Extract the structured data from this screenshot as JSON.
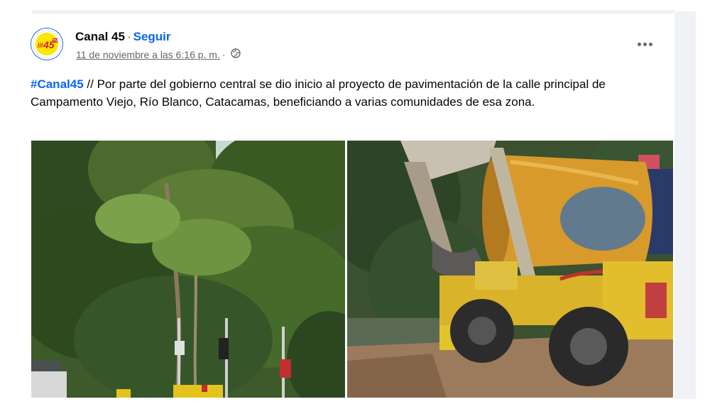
{
  "post": {
    "author": "Canal 45",
    "separator": "·",
    "follow_label": "Seguir",
    "timestamp": "11 de noviembre a las 6:16 p. m.",
    "meta_separator": "·",
    "audience_icon": "globe-icon",
    "more_icon": "more-options-icon",
    "hashtag": "#Canal45",
    "text": " // Por parte del gobierno central se dio inicio al proyecto de pavimentación de la calle principal de Campamento Viejo, Río Blanco, Catacamas,  beneficiando a varias comunidades de esa zona."
  },
  "avatar": {
    "logo_text": "45",
    "logo_prefix": "///",
    "logo_badge": "TV"
  },
  "photos": [
    {
      "name": "photo-forest-street",
      "icon": "photo"
    },
    {
      "name": "photo-concrete-mixer",
      "icon": "photo"
    }
  ],
  "colors": {
    "link_blue": "#0866ff",
    "meta_gray": "#65676b",
    "text_dark": "#050505",
    "rail_gray": "#f0f2f5"
  }
}
